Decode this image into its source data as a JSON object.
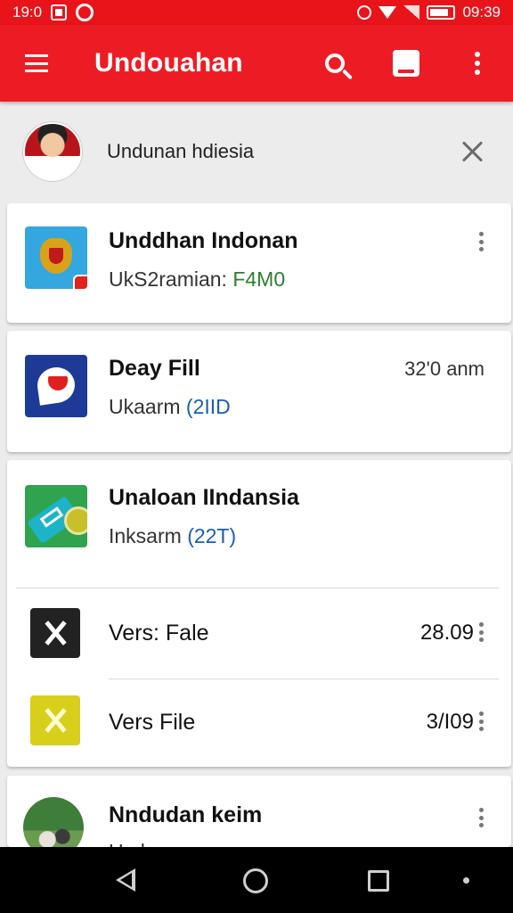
{
  "status_bar": {
    "time_left": "19:0",
    "time_right": "09:39",
    "icons_left": [
      "notification-box-icon",
      "circle-app-icon"
    ],
    "icons_right": [
      "alarm-icon",
      "wifi-icon",
      "signal-icon",
      "battery-icon"
    ]
  },
  "app_bar": {
    "title": "Undouahan",
    "background": "#ed1c24",
    "actions": [
      "search-icon",
      "save-icon",
      "more-vert-icon"
    ]
  },
  "profile": {
    "name": "Undunan hdiesia"
  },
  "list": {
    "items": [
      {
        "title": "Unddhan Indonan",
        "subtitle_label": "UkS2ramian: ",
        "subtitle_value": "F4M0",
        "icon": "garuda-icon"
      },
      {
        "title": "Deay Fill",
        "subtitle_label": "Ukaarm ",
        "subtitle_value": "(2IID",
        "time": "32'0 anm",
        "icon": "flag-icon"
      },
      {
        "title": "Unaloan IIndansia",
        "subtitle_label": "Inksarm ",
        "subtitle_value": "(22T)",
        "icon": "document-icon"
      },
      {
        "title": "Vers: Fale",
        "value": "28.09",
        "icon": "file-dark-icon"
      },
      {
        "title": "Vers File",
        "value": "3/I09",
        "icon": "file-yellow-icon"
      },
      {
        "title": "Nndudan keim",
        "subtitle_label": "Ur..l...",
        "icon": "photo-avatar-icon"
      }
    ]
  },
  "nav_bar": {
    "buttons": [
      "back-icon",
      "home-icon",
      "recents-icon",
      "dot-icon"
    ]
  }
}
